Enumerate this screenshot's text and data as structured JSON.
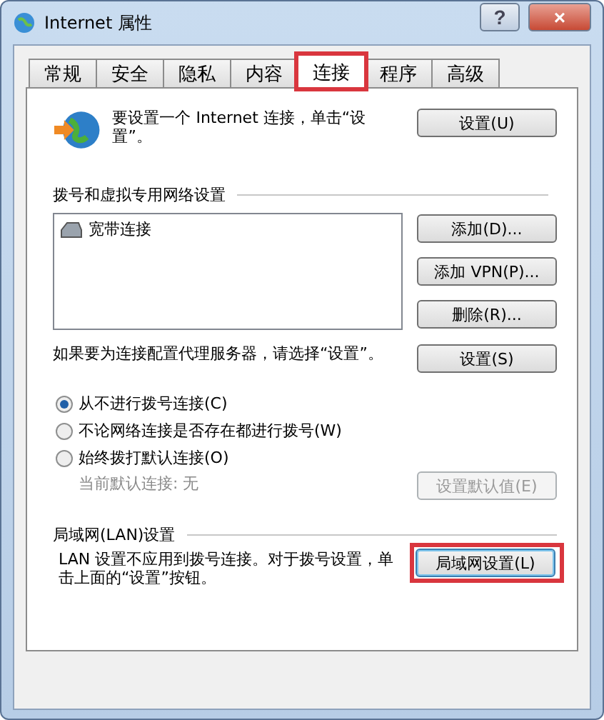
{
  "window": {
    "title": "Internet 属性",
    "help_button": "?",
    "close_button": "×"
  },
  "tabs": [
    {
      "label": "常规",
      "selected": false,
      "highlighted": false
    },
    {
      "label": "安全",
      "selected": false,
      "highlighted": false
    },
    {
      "label": "隐私",
      "selected": false,
      "highlighted": false
    },
    {
      "label": "内容",
      "selected": false,
      "highlighted": false
    },
    {
      "label": "连接",
      "selected": true,
      "highlighted": true
    },
    {
      "label": "程序",
      "selected": false,
      "highlighted": false
    },
    {
      "label": "高级",
      "selected": false,
      "highlighted": false
    }
  ],
  "setup": {
    "text": "要设置一个 Internet 连接，单击“设置”。",
    "button": "设置(U)"
  },
  "dialup": {
    "heading": "拨号和虚拟专用网络设置",
    "connections": [
      {
        "label": "宽带连接",
        "selected": false
      }
    ],
    "buttons": [
      {
        "label": "添加(D)...",
        "disabled": false
      },
      {
        "label": "添加 VPN(P)...",
        "disabled": false
      },
      {
        "label": "删除(R)..."
      }
    ],
    "proxy_text": "如果要为连接配置代理服务器，请选择“设置”。",
    "proxy_button": "设置(S)",
    "options": [
      {
        "label": "从不进行拨号连接(C)",
        "selected": true
      },
      {
        "label": "不论网络连接是否存在都进行拨号(W)",
        "selected": false
      },
      {
        "label": "始终拨打默认连接(O)",
        "selected": false
      }
    ],
    "current_default": {
      "text": "当前默认连接: 无",
      "disabled": true
    },
    "default_button": {
      "label": "设置默认值(E)",
      "disabled": true
    }
  },
  "lan": {
    "heading": "局域网(LAN)设置",
    "text": "LAN 设置不应用到拨号连接。对于拨号设置，单击上面的“设置”按钮。",
    "button": {
      "label": "局域网设置(L)",
      "focused": true,
      "highlighted": true
    }
  }
}
